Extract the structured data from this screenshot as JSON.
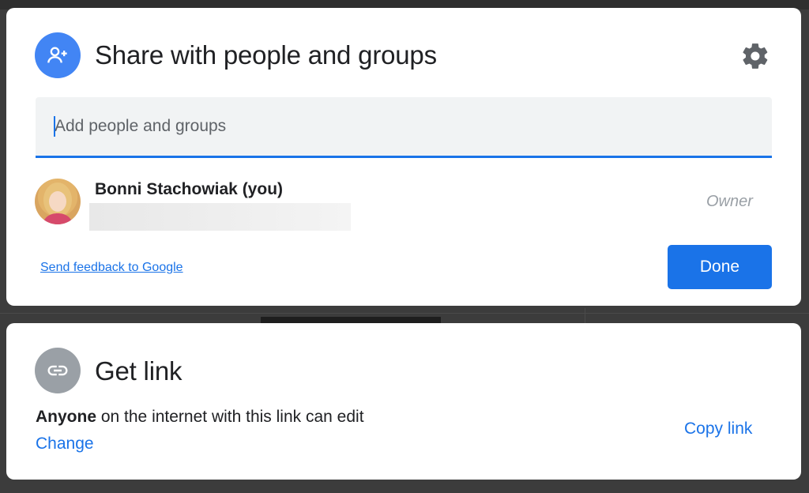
{
  "share_dialog": {
    "title": "Share with people and groups",
    "icon": "add-person-icon",
    "settings_icon": "gear-icon",
    "add_input": {
      "value": "",
      "placeholder": "Add people and groups"
    },
    "people": [
      {
        "name": "Bonni Stachowiak (you)",
        "role": "Owner"
      }
    ],
    "feedback_link": "Send feedback to Google",
    "done_label": "Done"
  },
  "link_dialog": {
    "title": "Get link",
    "icon": "link-icon",
    "access_scope": "Anyone",
    "access_rest": " on the internet with this link can edit",
    "change_label": "Change",
    "copy_label": "Copy link"
  },
  "colors": {
    "accent": "#1a73e8",
    "share_icon_bg": "#4285f4",
    "link_icon_bg": "#9aa0a6"
  }
}
